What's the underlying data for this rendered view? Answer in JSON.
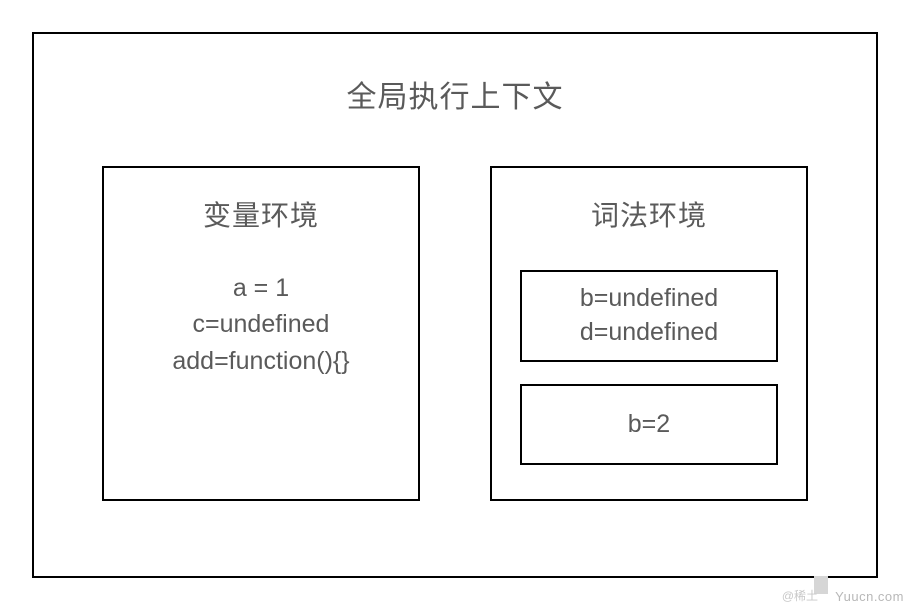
{
  "title": "全局执行上下文",
  "leftPanel": {
    "title": "变量环境",
    "lines": [
      "a = 1",
      "c=undefined",
      "add=function(){}"
    ]
  },
  "rightPanel": {
    "title": "词法环境",
    "scopes": [
      {
        "lines": [
          "b=undefined",
          "d=undefined"
        ]
      },
      {
        "lines": [
          "b=2"
        ]
      }
    ]
  },
  "watermark": {
    "left": "@稀土",
    "right": "Yuucn.com"
  }
}
